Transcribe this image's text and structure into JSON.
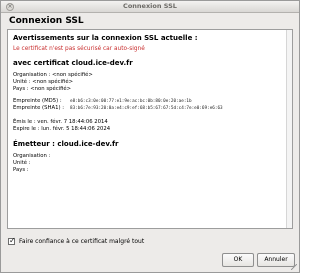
{
  "window": {
    "title": "Connexion SSL"
  },
  "header": {
    "title": "Connexion SSL"
  },
  "content": {
    "warnings_heading": "Avertissements sur la connexion SSL actuelle :",
    "warning_text": "Le certificat n'est pas sécurisé car auto-signé",
    "cert_heading": "avec certificat cloud.ice-dev.fr",
    "cert": {
      "org_line": "Organisation : <non spécifié>",
      "unit_line": "Unité : <non spécifié>",
      "country_line": "Pays : <non spécifié>",
      "md5_label": "Empreinte (MD5) :",
      "md5_value": "e8:b6:c3:0e:00:77:e1:9e:ac:bc:0b:80:0e:20:ae:1b",
      "sha1_label": "Empreinte (SHA1) :",
      "sha1_value": "83:b6:7e:93:20:0a:e4:c9:ef:68:b5:67:67:5d:c4:7e:e0:69:e6:63",
      "issued_line": "Émis le : ven. févr. 7 18:44:06 2014",
      "expires_line": "Expire le : lun. févr. 5 18:44:06 2024"
    },
    "issuer_heading": "Émetteur : cloud.ice-dev.fr",
    "issuer": {
      "org_line": "Organisation :",
      "unit_line": "Unité :",
      "country_line": "Pays :"
    }
  },
  "footer": {
    "trust_checkbox_label": "Faire confiance à ce certificat malgré tout",
    "trust_checked": true,
    "ok_label": "OK",
    "cancel_label": "Annuler"
  }
}
